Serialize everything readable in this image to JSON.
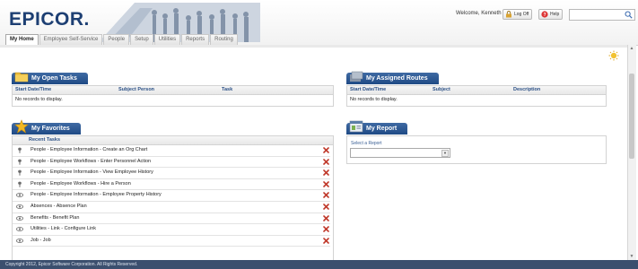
{
  "header": {
    "logo_text": "EPICOR.",
    "welcome": "Welcome, Kenneth",
    "logoff_label": "Log Off",
    "help_label": "Help",
    "search_value": ""
  },
  "tabs": [
    {
      "label": "My Home",
      "active": true
    },
    {
      "label": "Employee Self-Service"
    },
    {
      "label": "People"
    },
    {
      "label": "Setup"
    },
    {
      "label": "Utilities"
    },
    {
      "label": "Reports"
    },
    {
      "label": "Routing"
    }
  ],
  "open_tasks": {
    "title": "My Open Tasks",
    "columns": [
      "Start Date/Time",
      "Subject Person",
      "Task"
    ],
    "empty": "No records to display."
  },
  "assigned_routes": {
    "title": "My Assigned Routes",
    "columns": [
      "Start Date/Time",
      "Subject",
      "Description"
    ],
    "empty": "No records to display."
  },
  "favorites": {
    "title": "My Favorites",
    "header": "Recent Tasks",
    "rows": [
      {
        "label": "People - Employee Information - Create an Org Chart",
        "icon": "pin-icon"
      },
      {
        "label": "People - Employee Workflows - Enter Personnel Action",
        "icon": "pin-icon"
      },
      {
        "label": "People - Employee Information - View Employee History",
        "icon": "pin-icon"
      },
      {
        "label": "People - Employee Workflows - Hire a Person",
        "icon": "pin-icon"
      },
      {
        "label": "People - Employee Information - Employee Property History",
        "icon": "eye-icon"
      },
      {
        "label": "Absences - Absence Plan",
        "icon": "eye-icon"
      },
      {
        "label": "Benefits - Benefit Plan",
        "icon": "eye-icon"
      },
      {
        "label": "Utilities - Link - Configure Link",
        "icon": "eye-icon"
      },
      {
        "label": "Job - Job",
        "icon": "eye-icon"
      }
    ]
  },
  "report": {
    "title": "My Report",
    "select_label": "Select a Report",
    "select_value": ""
  },
  "footer": {
    "copyright": "Copyright 2012, Epicor Software Corporation. All Rights Reserved."
  },
  "colors": {
    "brand": "#1d3f73",
    "panel_title": "#2b5797",
    "remove": "#c0392b"
  }
}
